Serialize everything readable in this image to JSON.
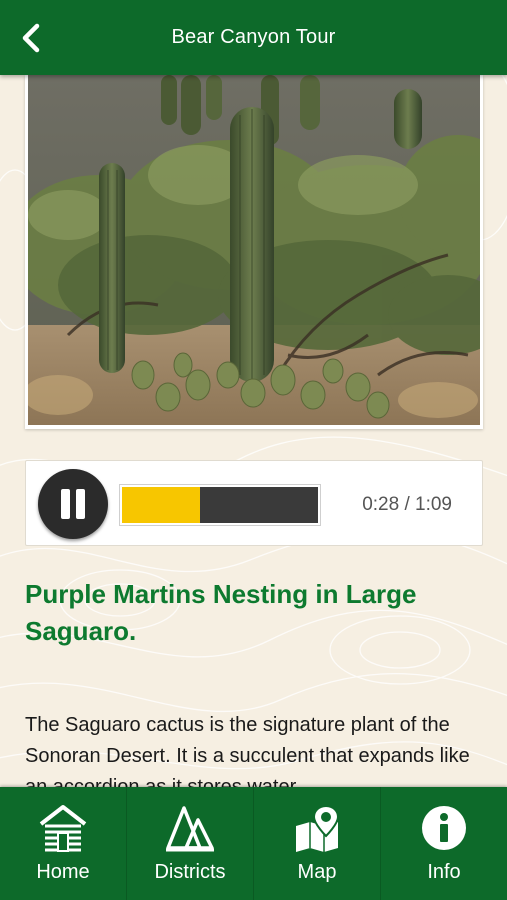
{
  "header": {
    "title": "Bear Canyon Tour",
    "back_icon": "chevron-left-icon"
  },
  "photo": {
    "description_icon": "saguaro-photo"
  },
  "player": {
    "state_icon": "pause-icon",
    "progress": 0.4,
    "time": "0:28 / 1:09",
    "progress_color": "#f7c600"
  },
  "content": {
    "heading": "Purple Martins Nesting in Large Saguaro.",
    "body": "The Saguaro cactus is the signature plant of the Sonoran Desert. It is a succulent that expands like an accordion as it stores water"
  },
  "tabs": [
    {
      "label": "Home",
      "icon": "cabin-icon"
    },
    {
      "label": "Districts",
      "icon": "tents-icon"
    },
    {
      "label": "Map",
      "icon": "map-pin-icon"
    },
    {
      "label": "Info",
      "icon": "info-icon"
    }
  ],
  "colors": {
    "brand": "#0d6a2a",
    "heading": "#0d7a2f",
    "background": "#f6efe2"
  }
}
